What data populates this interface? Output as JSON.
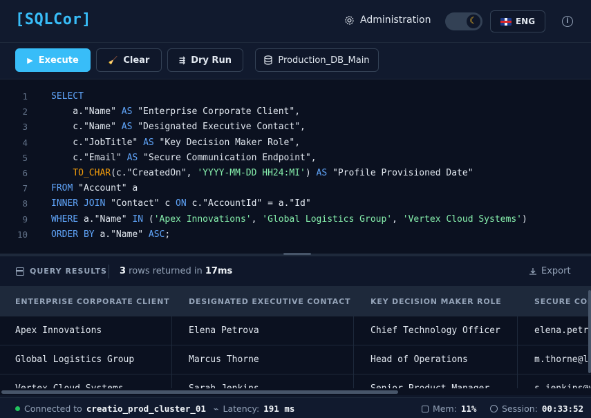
{
  "app": {
    "logo_open": "[",
    "logo_text": "SQLCor",
    "logo_close": "]"
  },
  "header": {
    "admin_label": "Administration",
    "theme_icon": "moon-icon",
    "lang_label": "ENG",
    "info_icon": "info-icon"
  },
  "toolbar": {
    "execute_label": "Execute",
    "clear_label": "Clear",
    "dry_run_label": "Dry Run",
    "db_label": "Production_DB_Main"
  },
  "editor": {
    "line_numbers": [
      "1",
      "2",
      "3",
      "4",
      "5",
      "6",
      "7",
      "8",
      "9",
      "10"
    ],
    "lines": [
      [
        {
          "t": "SELECT",
          "c": "kw"
        }
      ],
      [
        {
          "t": "    a.\"Name\" ",
          "c": ""
        },
        {
          "t": "AS",
          "c": "kw"
        },
        {
          "t": " \"Enterprise Corporate Client\",",
          "c": ""
        }
      ],
      [
        {
          "t": "    c.\"Name\" ",
          "c": ""
        },
        {
          "t": "AS",
          "c": "kw"
        },
        {
          "t": " \"Designated Executive Contact\",",
          "c": ""
        }
      ],
      [
        {
          "t": "    c.\"JobTitle\" ",
          "c": ""
        },
        {
          "t": "AS",
          "c": "kw"
        },
        {
          "t": " \"Key Decision Maker Role\",",
          "c": ""
        }
      ],
      [
        {
          "t": "    c.\"Email\" ",
          "c": ""
        },
        {
          "t": "AS",
          "c": "kw"
        },
        {
          "t": " \"Secure Communication Endpoint\",",
          "c": ""
        }
      ],
      [
        {
          "t": "    ",
          "c": ""
        },
        {
          "t": "TO_CHAR",
          "c": "fn"
        },
        {
          "t": "(c.\"CreatedOn\", ",
          "c": ""
        },
        {
          "t": "'YYYY-MM-DD HH24:MI'",
          "c": "str"
        },
        {
          "t": ") ",
          "c": ""
        },
        {
          "t": "AS",
          "c": "kw"
        },
        {
          "t": " \"Profile Provisioned Date\"",
          "c": ""
        }
      ],
      [
        {
          "t": "FROM",
          "c": "kw"
        },
        {
          "t": " \"Account\" a",
          "c": ""
        }
      ],
      [
        {
          "t": "INNER JOIN",
          "c": "kw"
        },
        {
          "t": " \"Contact\" c ",
          "c": ""
        },
        {
          "t": "ON",
          "c": "kw"
        },
        {
          "t": " c.\"AccountId\" = a.\"Id\"",
          "c": ""
        }
      ],
      [
        {
          "t": "WHERE",
          "c": "kw"
        },
        {
          "t": " a.\"Name\" ",
          "c": ""
        },
        {
          "t": "IN",
          "c": "kw"
        },
        {
          "t": " (",
          "c": ""
        },
        {
          "t": "'Apex Innovations'",
          "c": "str"
        },
        {
          "t": ", ",
          "c": ""
        },
        {
          "t": "'Global Logistics Group'",
          "c": "str"
        },
        {
          "t": ", ",
          "c": ""
        },
        {
          "t": "'Vertex Cloud Systems'",
          "c": "str"
        },
        {
          "t": ")",
          "c": ""
        }
      ],
      [
        {
          "t": "ORDER BY",
          "c": "kw"
        },
        {
          "t": " a.\"Name\" ",
          "c": ""
        },
        {
          "t": "ASC",
          "c": "kw"
        },
        {
          "t": ";",
          "c": ""
        }
      ]
    ]
  },
  "results": {
    "title": "QUERY RESULTS",
    "row_count": "3",
    "count_text": " rows returned in ",
    "duration": "17ms",
    "export_label": "Export",
    "columns": [
      "ENTERPRISE CORPORATE CLIENT",
      "DESIGNATED EXECUTIVE CONTACT",
      "KEY DECISION MAKER ROLE",
      "SECURE COMMUNICATION ENDPOINT"
    ],
    "rows": [
      [
        "Apex Innovations",
        "Elena Petrova",
        "Chief Technology Officer",
        "elena.petrova@apex.io"
      ],
      [
        "Global Logistics Group",
        "Marcus Thorne",
        "Head of Operations",
        "m.thorne@logistics.com"
      ],
      [
        "Vertex Cloud Systems",
        "Sarah Jenkins",
        "Senior Product Manager",
        "s.jenkins@vertex.cloud"
      ]
    ]
  },
  "status": {
    "connected_text": "Connected to ",
    "cluster": "creatio_prod_cluster_01",
    "latency_label": "Latency: ",
    "latency_value": "191 ms",
    "mem_label": "Mem: ",
    "mem_value": "11%",
    "session_label": "Session: ",
    "session_value": "00:33:52"
  },
  "colors": {
    "accent": "#38bdf8",
    "keyword": "#60a5fa",
    "function": "#f59e0b",
    "string": "#86efac",
    "connected": "#22c55e"
  }
}
